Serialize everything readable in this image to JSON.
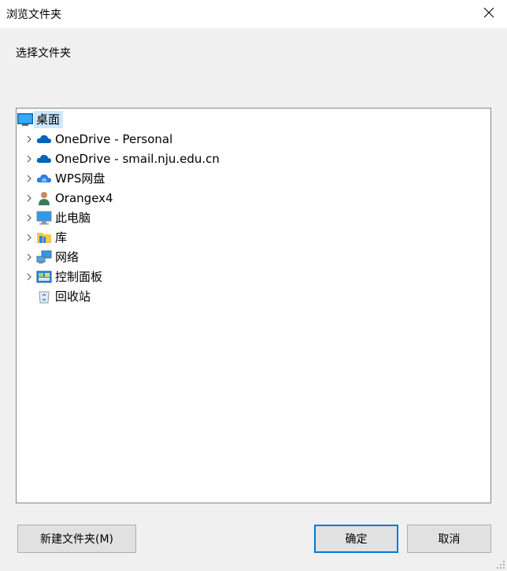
{
  "window": {
    "title": "浏览文件夹"
  },
  "prompt": "选择文件夹",
  "tree": {
    "root": {
      "label": "桌面",
      "icon": "desktop-icon"
    },
    "items": [
      {
        "label": "OneDrive - Personal",
        "icon": "onedrive-personal-icon",
        "expandable": true
      },
      {
        "label": "OneDrive - smail.nju.edu.cn",
        "icon": "onedrive-business-icon",
        "expandable": true
      },
      {
        "label": "WPS网盘",
        "icon": "wps-cloud-icon",
        "expandable": true
      },
      {
        "label": "Orangex4",
        "icon": "user-icon",
        "expandable": true
      },
      {
        "label": "此电脑",
        "icon": "computer-icon",
        "expandable": true
      },
      {
        "label": "库",
        "icon": "library-icon",
        "expandable": true
      },
      {
        "label": "网络",
        "icon": "network-icon",
        "expandable": true
      },
      {
        "label": "控制面板",
        "icon": "control-panel-icon",
        "expandable": true
      },
      {
        "label": "回收站",
        "icon": "recycle-bin-icon",
        "expandable": false
      }
    ]
  },
  "buttons": {
    "new_folder": "新建文件夹(M)",
    "ok": "确定",
    "cancel": "取消"
  },
  "colors": {
    "selection": "#cce8ff",
    "accent": "#0078d7",
    "onedrive": "#0364b8"
  }
}
